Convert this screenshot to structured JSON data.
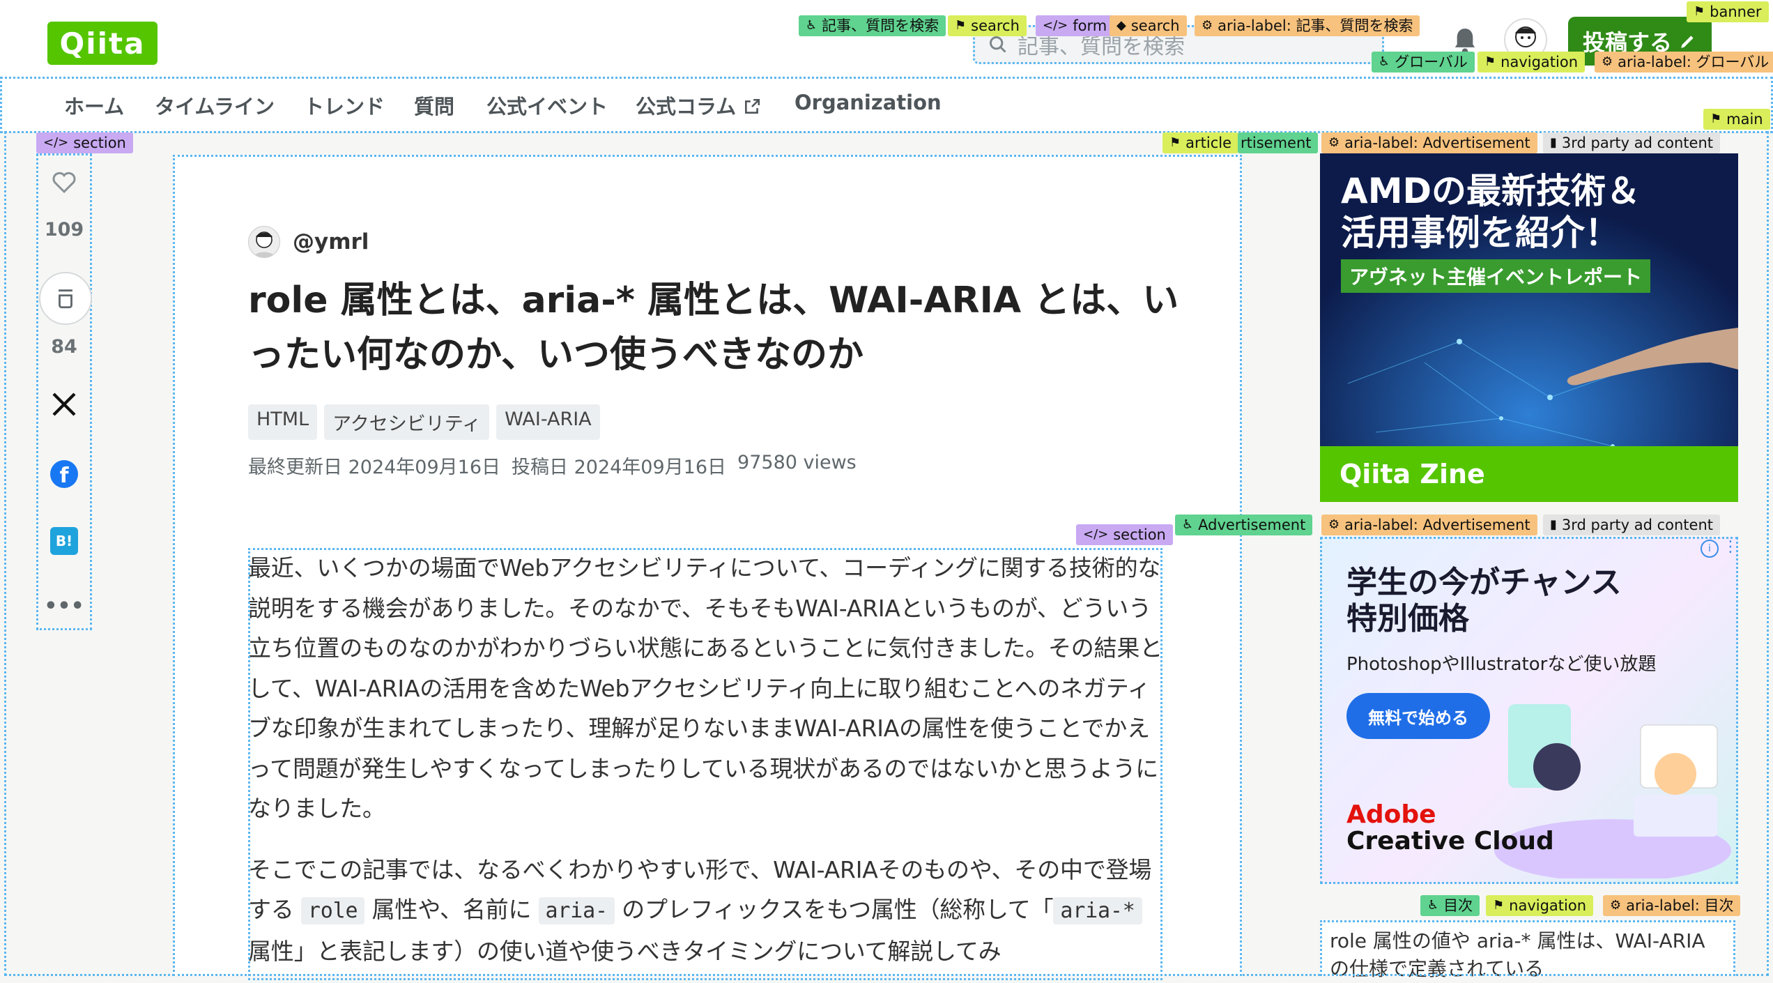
{
  "header": {
    "logo": "Qiita",
    "search_placeholder": "記事、質問を検索",
    "post_button": "投稿する"
  },
  "gnav": {
    "items": [
      "ホーム",
      "タイムライン",
      "トレンド",
      "質問",
      "公式イベント",
      "公式コラム",
      "Organization"
    ]
  },
  "landmarks": {
    "search_acc": "記事、質問を検索",
    "search": "search",
    "form": "form",
    "search_role": "search",
    "search_aria": "aria-label: 記事、質問を検索",
    "banner": "banner",
    "global_acc": "グローバル",
    "navigation": "navigation",
    "global_aria": "aria-label: グローバル",
    "main": "main",
    "section": "section",
    "article": "article",
    "advertisement_partial": "rtisement",
    "ad_aria": "aria-label: Advertisement",
    "third_party": "3rd party ad content",
    "advertisement": "Advertisement",
    "body_section": "section",
    "toc_acc": "目次",
    "toc_nav": "navigation",
    "toc_aria": "aria-label: 目次"
  },
  "rail": {
    "like_count": "109",
    "stock_count": "84"
  },
  "article": {
    "author": "@ymrl",
    "title": "role 属性とは、aria-* 属性とは、WAI-ARIA とは、いったい何なのか、いつ使うべきなのか",
    "tags": [
      "HTML",
      "アクセシビリティ",
      "WAI-ARIA"
    ],
    "updated": "最終更新日 2024年09月16日",
    "posted": "投稿日 2024年09月16日",
    "views": "97580 views",
    "para1": "最近、いくつかの場面でWebアクセシビリティについて、コーディングに関する技術的な説明をする機会がありました。そのなかで、そもそもWAI-ARIAというものが、どういう立ち位置のものなのかがわかりづらい状態にあるということに気付きました。その結果として、WAI-ARIAの活用を含めたWebアクセシビリティ向上に取り組むことへのネガティブな印象が生まれてしまったり、理解が足りないままWAI-ARIAの属性を使うことでかえって問題が発生しやすくなってしまったりしている現状があるのではないかと思うようになりました。",
    "para2_a": "そこでこの記事では、なるべくわかりやすい形で、WAI-ARIAそのものや、その中で登場する ",
    "code1": "role",
    "para2_b": " 属性や、名前に ",
    "code2": "aria-",
    "para2_c": " のプレフィックスをもつ属性（総称して「",
    "code3": "aria-*",
    "para2_d": " 属性」と表記します）の使い道や使うべきタイミングについて解説してみ"
  },
  "ads": {
    "ad1_title1": "AMDの最新技術＆",
    "ad1_title2": "活用事例を紹介！",
    "ad1_sub": "アヴネット主催イベントレポート",
    "ad1_brand": "Qiita Zine",
    "ad2_title1": "学生の今がチャンス",
    "ad2_title2": "特別価格",
    "ad2_sub": "PhotoshopやIllustratorなど使い放題",
    "ad2_cta": "無料で始める",
    "ad2_brand1": "Adobe",
    "ad2_brand2": "Creative Cloud"
  },
  "toc": {
    "text": "role 属性の値や aria-* 属性は、WAI-ARIA の仕様で定義されている"
  },
  "colors": {
    "brand": "#55c500",
    "post_button": "#2f8a16"
  }
}
